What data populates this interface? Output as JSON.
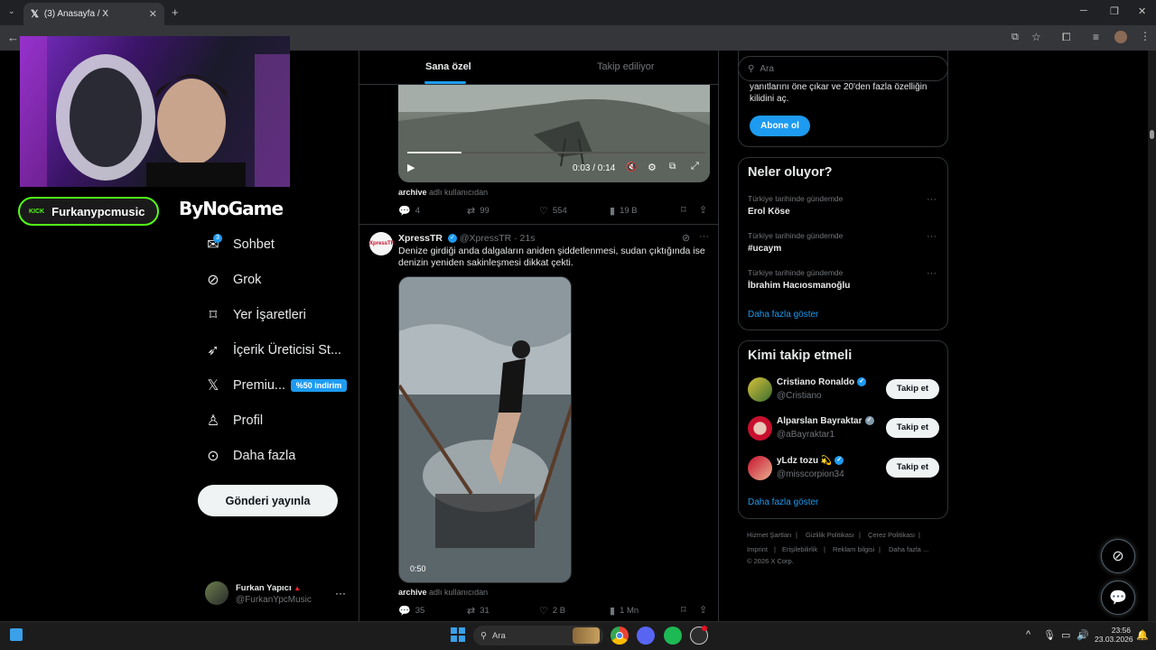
{
  "browser": {
    "tab_title": "(3) Anasayfa / X",
    "tab_icon": "x-logo-icon"
  },
  "stream_overlay": {
    "kick_label": "KICK",
    "kick_name": "Furkanypcmusic",
    "brand": "ByNoGame"
  },
  "nav": {
    "items": [
      {
        "label": "Sohbet",
        "icon": "chat-icon"
      },
      {
        "label": "Grok",
        "icon": "grok-icon"
      },
      {
        "label": "Yer İşaretleri",
        "icon": "bookmark-icon"
      },
      {
        "label": "İçerik Üreticisi St...",
        "icon": "rocket-icon"
      },
      {
        "label": "Premiu...",
        "icon": "x-logo-icon"
      },
      {
        "label": "Profil",
        "icon": "person-icon"
      },
      {
        "label": "Daha fazla",
        "icon": "more-circle-icon"
      }
    ],
    "chat_badge": "3",
    "premium_badge": "%50 indirim",
    "post_button": "Gönderi yayınla"
  },
  "account": {
    "name": "Furkan Yapıcı",
    "handle": "@FurkanYpcMusic"
  },
  "feed": {
    "tabs": [
      "Sana özel",
      "Takip ediliyor"
    ],
    "active_tab": "Sana özel",
    "post1": {
      "video_time": "0:03 / 0:14",
      "source_user": "archive",
      "source_suffix": "adlı kullanıcıdan",
      "replies": "4",
      "reposts": "99",
      "likes": "554",
      "views": "19 B"
    },
    "post2": {
      "author": "XpressTR",
      "handle": "@XpressTR",
      "time": "· 21s",
      "text": "Denize girdiği anda dalgaların aniden şiddetlenmesi, sudan çıktığında ise denizin yeniden sakinleşmesi dikkat çekti.",
      "video_duration": "0:50",
      "source_user": "archive",
      "source_suffix": "adlı kullanıcıdan",
      "replies": "35",
      "reposts": "31",
      "likes": "2 B",
      "views": "1 Mn"
    }
  },
  "sidebar": {
    "search_placeholder": "Ara",
    "premium_text_line1": "yanıtlarını öne çıkar ve 20'den fazla özelliğin",
    "premium_text_line2": "kilidini aç.",
    "subscribe_button": "Abone ol",
    "trends": {
      "title": "Neler oluyor?",
      "items": [
        {
          "category": "Türkiye tarihinde gündemde",
          "name": "Erol Köse"
        },
        {
          "category": "Türkiye tarihinde gündemde",
          "name": "#ucaym"
        },
        {
          "category": "Türkiye tarihinde gündemde",
          "name": "İbrahim Hacıosmanoğlu"
        }
      ],
      "show_more": "Daha fazla göster"
    },
    "who_to_follow": {
      "title": "Kimi takip etmeli",
      "users": [
        {
          "name": "Cristiano Ronaldo",
          "handle": "@Cristiano",
          "badge_color": "#1d9bf0"
        },
        {
          "name": "Alparslan Bayraktar",
          "handle": "@aBayraktar1",
          "badge_color": "#829aab"
        },
        {
          "name": "yLdz tozu 💫",
          "handle": "@misscorpion34",
          "badge_color": "#1d9bf0"
        }
      ],
      "follow_label": "Takip et",
      "show_more": "Daha fazla göster"
    },
    "footer": {
      "links": [
        "Hizmet Şartları",
        "Gizlilik Politikası",
        "Çerez Politikası",
        "Imprint",
        "Erişilebilirlik",
        "Reklam bilgisi",
        "Daha fazla ..."
      ],
      "copyright": "© 2026 X Corp."
    }
  },
  "taskbar": {
    "search_placeholder": "Ara",
    "time": "23:56",
    "date": "23.03.2026"
  },
  "colors": {
    "accent": "#1d9bf0",
    "kick_green": "#53fc18"
  }
}
